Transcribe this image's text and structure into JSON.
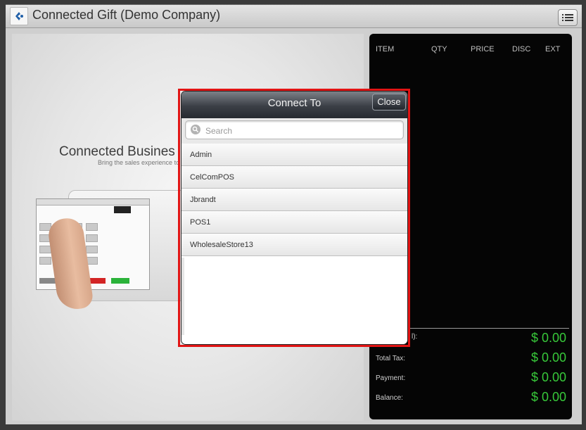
{
  "window": {
    "title": "Connected Gift (Demo Company)",
    "logo_icon": "connected-logo-icon",
    "menu_icon": "list-menu-icon"
  },
  "promo": {
    "title": "Connected Busines",
    "subtitle": "Bring the sales experience to"
  },
  "order": {
    "columns": [
      "ITEM",
      "QTY",
      "PRICE",
      "DISC",
      "EXT"
    ],
    "subtotal_label_clipped": "l):",
    "totals": [
      {
        "label": "",
        "value": "$ 0.00"
      },
      {
        "label": "Total Tax:",
        "value": "$ 0.00"
      },
      {
        "label": "Payment:",
        "value": "$ 0.00"
      },
      {
        "label": "Balance:",
        "value": "$ 0.00"
      }
    ],
    "value_color": "#38c93a"
  },
  "dialog": {
    "title": "Connect To",
    "close_label": "Close",
    "search_placeholder": "Search",
    "search_value": "",
    "items": [
      "Admin",
      "CelComPOS",
      "Jbrandt",
      "POS1",
      "WholesaleStore13"
    ],
    "highlight_color": "#e11414"
  }
}
